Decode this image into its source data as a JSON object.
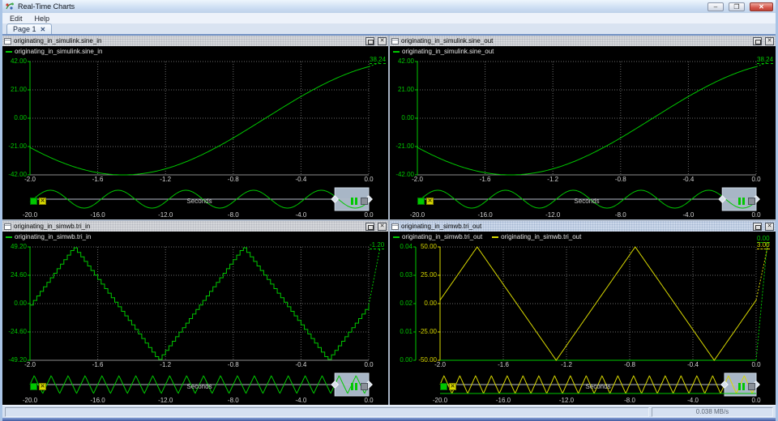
{
  "window": {
    "title": "Real-Time Charts",
    "menu": [
      "Edit",
      "Help"
    ],
    "tab_label": "Page 1",
    "status_rate": "0.038 MB/s"
  },
  "icons": {
    "minimize": "–",
    "close": "✕",
    "tab_close": "✕",
    "panel_close": "✕",
    "clear": "✕"
  },
  "colors": {
    "green": "#00c800",
    "yellow": "#d8d800",
    "grid": "#6a6a6a",
    "axis_bottom": "#8c8c8c",
    "tick_text": "#d2d2d2",
    "selection_fill": "#a8b6c6",
    "selection_edge": "#cdd8e4"
  },
  "chart_data": [
    {
      "type": "line",
      "title": "originating_in_simulink.sine_in",
      "series": [
        {
          "name": "originating_in_simulink.sine_in",
          "color": "green",
          "axis": 0,
          "signal": {
            "kind": "sine",
            "amplitude": 42,
            "period": 3.36,
            "min_at": -1.45
          }
        }
      ],
      "y_axes": [
        {
          "color": "green",
          "min": -42,
          "max": 42,
          "ticks": [
            "42.00",
            "21.00",
            "0.00",
            "-21.00",
            "-42.00"
          ]
        }
      ],
      "x_range": [
        -2,
        0
      ],
      "x_ticks": [
        "-2.0",
        "-1.6",
        "-1.2",
        "-0.8",
        "-0.4",
        "0.0"
      ],
      "x_label": "Seconds",
      "value_labels": [
        {
          "text": "38.24",
          "color": "green"
        }
      ],
      "overview": {
        "range": [
          -20,
          0
        ],
        "selection": [
          -2,
          0
        ],
        "x_ticks": [
          "-20.0",
          "-16.0",
          "-12.0",
          "-8.0",
          "-4.0",
          "0.0"
        ],
        "series": [
          {
            "color": "green",
            "kind": "sine",
            "period": 4,
            "min_at": -0.8
          }
        ]
      }
    },
    {
      "type": "line",
      "title": "originating_in_simulink.sine_out",
      "series": [
        {
          "name": "originating_in_simulink.sine_out",
          "color": "green",
          "axis": 0,
          "signal": {
            "kind": "sine",
            "amplitude": 42,
            "period": 3.36,
            "min_at": -1.45
          }
        }
      ],
      "y_axes": [
        {
          "color": "green",
          "min": -42,
          "max": 42,
          "ticks": [
            "42.00",
            "21.00",
            "0.00",
            "-21.00",
            "-42.00"
          ]
        }
      ],
      "x_range": [
        -2,
        0
      ],
      "x_ticks": [
        "-2.0",
        "-1.6",
        "-1.2",
        "-0.8",
        "-0.4",
        "0.0"
      ],
      "x_label": "Seconds",
      "value_labels": [
        {
          "text": "38.24",
          "color": "green"
        }
      ],
      "overview": {
        "range": [
          -20,
          0
        ],
        "selection": [
          -2,
          0
        ],
        "x_ticks": [
          "-20.0",
          "-16.0",
          "-12.0",
          "-8.0",
          "-4.0",
          "0.0"
        ],
        "series": [
          {
            "color": "green",
            "kind": "sine",
            "period": 4,
            "min_at": -0.8
          }
        ]
      }
    },
    {
      "type": "line",
      "title": "originating_in_simwb.tri_in",
      "series": [
        {
          "name": "originating_in_simwb.tri_in",
          "color": "green",
          "axis": 0,
          "signal": {
            "kind": "tri",
            "amplitude": 49.2,
            "period": 1,
            "zero_rise_at": -1.994,
            "quantize_dt": 0.02
          }
        }
      ],
      "y_axes": [
        {
          "color": "green",
          "min": -49.2,
          "max": 49.2,
          "ticks": [
            "49.20",
            "24.60",
            "0.00",
            "-24.60",
            "-49.20"
          ]
        }
      ],
      "x_range": [
        -2,
        0
      ],
      "x_ticks": [
        "-2.0",
        "-1.6",
        "-1.2",
        "-0.8",
        "-0.4",
        "0.0"
      ],
      "x_label": "Seconds",
      "value_labels": [
        {
          "text": "-1.20",
          "color": "green"
        }
      ],
      "overview": {
        "range": [
          -20,
          0
        ],
        "selection": [
          -2,
          0
        ],
        "x_ticks": [
          "-20.0",
          "-16.0",
          "-12.0",
          "-8.0",
          "-4.0",
          "0.0"
        ],
        "series": [
          {
            "color": "green",
            "kind": "tri",
            "period": 1,
            "zero_rise_at": -2
          }
        ]
      }
    },
    {
      "type": "line",
      "title": "originating_in_simwb.tri_out",
      "series": [
        {
          "name": "originating_in_simwb.tri_out",
          "color": "green",
          "axis": 0,
          "signal": {
            "kind": "flat",
            "value": 0
          }
        },
        {
          "name": "originating_in_simwb.tri_out",
          "color": "yellow",
          "axis": 1,
          "signal": {
            "kind": "tri",
            "amplitude": 50,
            "period": 1,
            "zero_rise_at": -2.015
          }
        }
      ],
      "y_axes": [
        {
          "color": "green",
          "min": 0,
          "max": 0.04,
          "ticks": [
            "0.04",
            "0.03",
            "0.02",
            "0.01",
            "0.00"
          ]
        },
        {
          "color": "yellow",
          "min": -50,
          "max": 50,
          "ticks": [
            "50.00",
            "25.00",
            "0.00",
            "-25.00",
            "-50.00"
          ]
        }
      ],
      "x_range": [
        -2,
        0
      ],
      "x_ticks": [
        "-2.0",
        "-1.6",
        "-1.2",
        "-0.8",
        "-0.4",
        "0.0"
      ],
      "x_label": "Seconds",
      "value_labels": [
        {
          "text": "0.00",
          "color": "green"
        },
        {
          "text": "3.00",
          "color": "yellow"
        }
      ],
      "overview": {
        "range": [
          -20,
          0
        ],
        "selection": [
          -2,
          0
        ],
        "x_ticks": [
          "-20.0",
          "-16.0",
          "-12.0",
          "-8.0",
          "-4.0",
          "0.0"
        ],
        "series": [
          {
            "color": "yellow",
            "kind": "tri",
            "period": 1,
            "zero_rise_at": -2
          },
          {
            "color": "green",
            "kind": "flat",
            "value": -1
          }
        ]
      }
    }
  ]
}
